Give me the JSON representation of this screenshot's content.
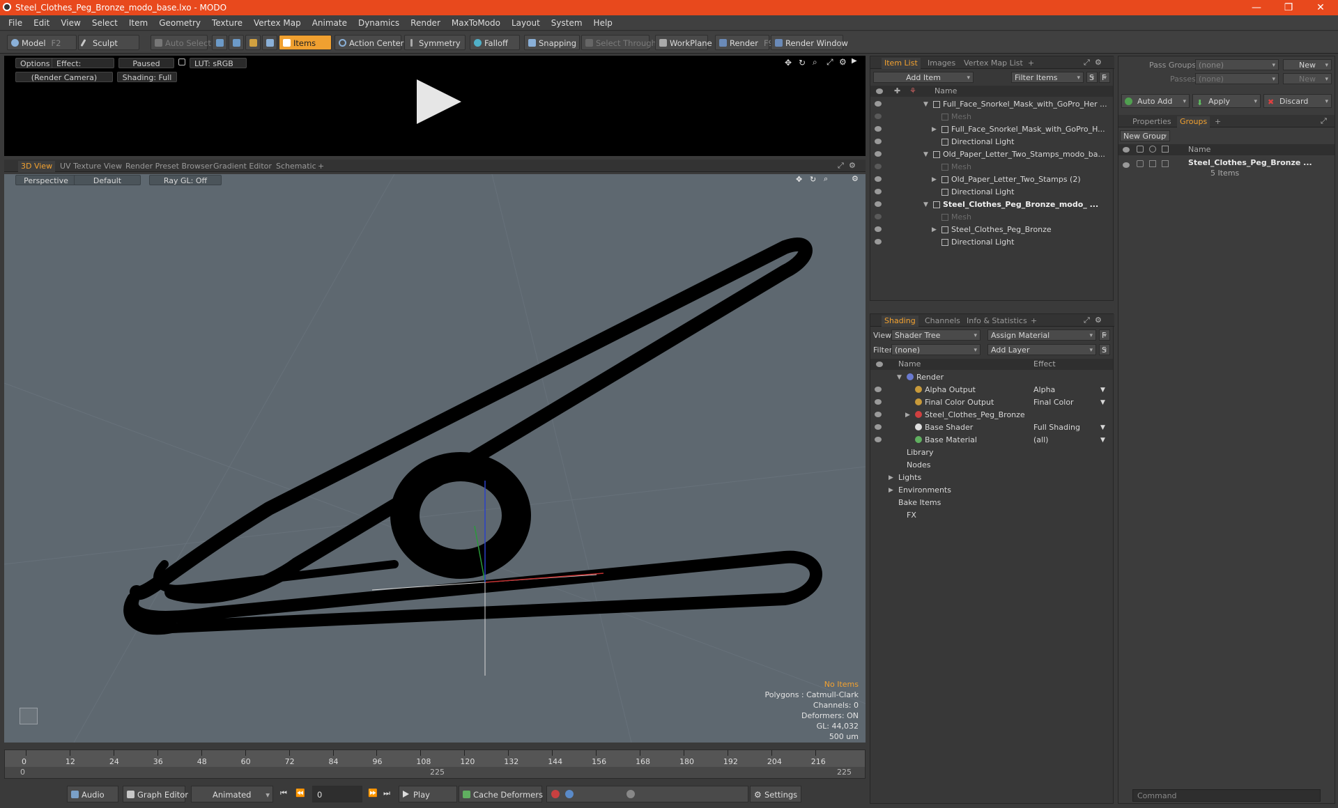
{
  "window": {
    "title": "Steel_Clothes_Peg_Bronze_modo_base.lxo - MODO",
    "controls": [
      "—",
      "❐",
      "✕"
    ]
  },
  "menu": [
    "File",
    "Edit",
    "View",
    "Select",
    "Item",
    "Geometry",
    "Texture",
    "Vertex Map",
    "Animate",
    "Dynamics",
    "Render",
    "MaxToModo",
    "Layout",
    "System",
    "Help"
  ],
  "toolbar": {
    "model": "Model",
    "model_key": "F2",
    "sculpt": "Sculpt",
    "auto_select": "Auto Select",
    "items": "Items",
    "action_center": "Action Center",
    "symmetry": "Symmetry",
    "falloff": "Falloff",
    "snapping": "Snapping",
    "select_through": "Select Through",
    "workplane": "WorkPlane",
    "render": "Render",
    "render_key": "F9",
    "render_window": "Render Window"
  },
  "preview": {
    "options": "Options",
    "effect": "Effect: (Shadi...",
    "paused": "Paused",
    "lut": "LUT: sRGB",
    "camera": "(Render Camera)",
    "shading": "Shading: Full"
  },
  "viewport_tabs": [
    "3D View",
    "UV Texture View",
    "Render Preset Browser",
    "Gradient Editor",
    "Schematic",
    "+"
  ],
  "viewport": {
    "perspective": "Perspective",
    "default": "Default",
    "raygl": "Ray GL: Off",
    "stats": [
      "No Items",
      "Polygons : Catmull-Clark",
      "Channels: 0",
      "Deformers: ON",
      "GL: 44,032",
      "500 um"
    ]
  },
  "timeline": {
    "ticks": [
      0,
      12,
      24,
      36,
      48,
      60,
      72,
      84,
      96,
      108,
      120,
      132,
      144,
      156,
      168,
      180,
      192,
      204,
      216
    ],
    "start": "0",
    "mid": "225",
    "end": "225"
  },
  "bottombar": {
    "audio": "Audio",
    "graph_editor": "Graph Editor",
    "animated": "Animated",
    "frame": "0",
    "play": "Play",
    "cache_deformers": "Cache Deformers",
    "settings": "Settings"
  },
  "itemlist": {
    "tabs": [
      "Item List",
      "Images",
      "Vertex Map List",
      "+"
    ],
    "add_item": "Add Item",
    "filter_items": "Filter Items",
    "s_btn": "S",
    "f_btn": "F",
    "name_header": "Name",
    "rows": [
      {
        "indent": 1,
        "arrow": "▼",
        "label": "Full_Face_Snorkel_Mask_with_GoPro_Her ...",
        "dim": false,
        "bold": false
      },
      {
        "indent": 2,
        "arrow": "",
        "label": "Mesh",
        "dim": true,
        "bold": false
      },
      {
        "indent": 2,
        "arrow": "▶",
        "label": "Full_Face_Snorkel_Mask_with_GoPro_H...",
        "dim": false,
        "bold": false
      },
      {
        "indent": 2,
        "arrow": "",
        "label": "Directional Light",
        "dim": false,
        "bold": false
      },
      {
        "indent": 1,
        "arrow": "▼",
        "label": "Old_Paper_Letter_Two_Stamps_modo_ba...",
        "dim": false,
        "bold": false
      },
      {
        "indent": 2,
        "arrow": "",
        "label": "Mesh",
        "dim": true,
        "bold": false
      },
      {
        "indent": 2,
        "arrow": "▶",
        "label": "Old_Paper_Letter_Two_Stamps (2)",
        "dim": false,
        "bold": false
      },
      {
        "indent": 2,
        "arrow": "",
        "label": "Directional Light",
        "dim": false,
        "bold": false
      },
      {
        "indent": 1,
        "arrow": "▼",
        "label": "Steel_Clothes_Peg_Bronze_modo_ ...",
        "dim": false,
        "bold": true
      },
      {
        "indent": 2,
        "arrow": "",
        "label": "Mesh",
        "dim": true,
        "bold": false
      },
      {
        "indent": 2,
        "arrow": "▶",
        "label": "Steel_Clothes_Peg_Bronze",
        "dim": false,
        "bold": false
      },
      {
        "indent": 2,
        "arrow": "",
        "label": "Directional Light",
        "dim": false,
        "bold": false
      }
    ]
  },
  "shading": {
    "tabs": [
      "Shading",
      "Channels",
      "Info & Statistics",
      "+"
    ],
    "view_label": "View",
    "view_value": "Shader Tree",
    "assign_material": "Assign Material",
    "filter_label": "Filter",
    "filter_value": "(none)",
    "add_layer": "Add Layer",
    "f_btn": "F",
    "s_btn": "S",
    "name_header": "Name",
    "effect_header": "Effect",
    "rows": [
      {
        "indent": 1,
        "arrow": "▼",
        "label": "Render",
        "effect": "",
        "eye": false,
        "swatch": "#6a7ad0"
      },
      {
        "indent": 2,
        "arrow": "",
        "label": "Alpha Output",
        "effect": "Alpha",
        "eye": true,
        "swatch": "#c89a3a"
      },
      {
        "indent": 2,
        "arrow": "",
        "label": "Final Color Output",
        "effect": "Final Color",
        "eye": true,
        "swatch": "#c89a3a"
      },
      {
        "indent": 2,
        "arrow": "▶",
        "label": "Steel_Clothes_Peg_Bronze",
        "effect": "",
        "eye": true,
        "swatch": "#d04040"
      },
      {
        "indent": 2,
        "arrow": "",
        "label": "Base Shader",
        "effect": "Full Shading",
        "eye": true,
        "swatch": "#e0e0e0"
      },
      {
        "indent": 2,
        "arrow": "",
        "label": "Base Material",
        "effect": "(all)",
        "eye": true,
        "swatch": "#60b060"
      },
      {
        "indent": 1,
        "arrow": "",
        "label": "Library",
        "effect": "",
        "eye": false,
        "swatch": ""
      },
      {
        "indent": 1,
        "arrow": "",
        "label": "Nodes",
        "effect": "",
        "eye": false,
        "swatch": ""
      },
      {
        "indent": 0,
        "arrow": "▶",
        "label": "Lights",
        "effect": "",
        "eye": false,
        "swatch": ""
      },
      {
        "indent": 0,
        "arrow": "▶",
        "label": "Environments",
        "effect": "",
        "eye": false,
        "swatch": ""
      },
      {
        "indent": 0,
        "arrow": "",
        "label": "Bake Items",
        "effect": "",
        "eye": false,
        "swatch": ""
      },
      {
        "indent": 1,
        "arrow": "",
        "label": "FX",
        "effect": "",
        "eye": false,
        "swatch": ""
      }
    ]
  },
  "groups": {
    "pass_groups_label": "Pass Groups",
    "pass_groups_value": "(none)",
    "new1": "New",
    "passes_label": "Passes",
    "passes_value": "(none)",
    "new2": "New",
    "auto_add": "Auto Add",
    "apply": "Apply",
    "discard": "Discard",
    "tabs": [
      "Properties",
      "Groups",
      "+"
    ],
    "new_group": "New Group",
    "name_header": "Name",
    "item_name": "Steel_Clothes_Peg_Bronze ...",
    "item_sub": "5 Items",
    "command_placeholder": "Command"
  },
  "colors": {
    "accent": "#f3a230",
    "titlebar": "#e8491d",
    "viewport_bg": "#5e6870"
  }
}
